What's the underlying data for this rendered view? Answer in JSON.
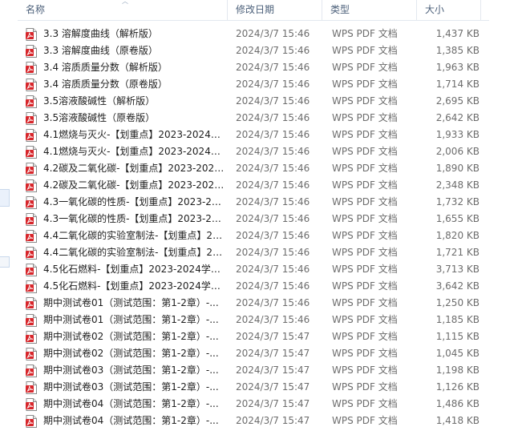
{
  "columns": {
    "name": "名称",
    "date": "修改日期",
    "type": "类型",
    "size": "大小"
  },
  "files": [
    {
      "name": "3.3  溶解度曲线（解析版）",
      "date": "2024/3/7 15:46",
      "type": "WPS PDF 文档",
      "size": "1,437 KB"
    },
    {
      "name": "3.3  溶解度曲线（原卷版）",
      "date": "2024/3/7 15:46",
      "type": "WPS PDF 文档",
      "size": "1,385 KB"
    },
    {
      "name": "3.4 溶质质量分数（解析版）",
      "date": "2024/3/7 15:46",
      "type": "WPS PDF 文档",
      "size": "1,963 KB"
    },
    {
      "name": "3.4 溶质质量分数（原卷版）",
      "date": "2024/3/7 15:46",
      "type": "WPS PDF 文档",
      "size": "1,714 KB"
    },
    {
      "name": "3.5溶液酸碱性（解析版）",
      "date": "2024/3/7 15:46",
      "type": "WPS PDF 文档",
      "size": "2,695 KB"
    },
    {
      "name": "3.5溶液酸碱性（原卷版）",
      "date": "2024/3/7 15:46",
      "type": "WPS PDF 文档",
      "size": "2,642 KB"
    },
    {
      "name": "4.1燃烧与灭火-【划重点】2023-2024学...",
      "date": "2024/3/7 15:46",
      "type": "WPS PDF 文档",
      "size": "1,933 KB"
    },
    {
      "name": "4.1燃烧与灭火-【划重点】2023-2024学...",
      "date": "2024/3/7 15:46",
      "type": "WPS PDF 文档",
      "size": "2,006 KB"
    },
    {
      "name": "4.2碳及二氧化碳-【划重点】2023-2024...",
      "date": "2024/3/7 15:46",
      "type": "WPS PDF 文档",
      "size": "1,890 KB"
    },
    {
      "name": "4.2碳及二氧化碳-【划重点】2023-2024...",
      "date": "2024/3/7 15:46",
      "type": "WPS PDF 文档",
      "size": "2,348 KB"
    },
    {
      "name": "4.3一氧化碳的性质-【划重点】2023-20...",
      "date": "2024/3/7 15:46",
      "type": "WPS PDF 文档",
      "size": "1,732 KB"
    },
    {
      "name": "4.3一氧化碳的性质-【划重点】2023-20...",
      "date": "2024/3/7 15:46",
      "type": "WPS PDF 文档",
      "size": "1,655 KB"
    },
    {
      "name": "4.4二氧化碳的实验室制法-【划重点】20...",
      "date": "2024/3/7 15:46",
      "type": "WPS PDF 文档",
      "size": "1,820 KB"
    },
    {
      "name": "4.4二氧化碳的实验室制法-【划重点】20...",
      "date": "2024/3/7 15:46",
      "type": "WPS PDF 文档",
      "size": "1,721 KB"
    },
    {
      "name": "4.5化石燃料-【划重点】2023-2024学年...",
      "date": "2024/3/7 15:46",
      "type": "WPS PDF 文档",
      "size": "3,713 KB"
    },
    {
      "name": "4.5化石燃料-【划重点】2023-2024学年...",
      "date": "2024/3/7 15:46",
      "type": "WPS PDF 文档",
      "size": "3,642 KB"
    },
    {
      "name": "期中测试卷01（测试范围：第1-2章）-...",
      "date": "2024/3/7 15:46",
      "type": "WPS PDF 文档",
      "size": "1,250 KB"
    },
    {
      "name": "期中测试卷01（测试范围：第1-2章）-...",
      "date": "2024/3/7 15:46",
      "type": "WPS PDF 文档",
      "size": "1,185 KB"
    },
    {
      "name": "期中测试卷02（测试范围：第1-2章）-...",
      "date": "2024/3/7 15:47",
      "type": "WPS PDF 文档",
      "size": "1,115 KB"
    },
    {
      "name": "期中测试卷02（测试范围：第1-2章）-...",
      "date": "2024/3/7 15:47",
      "type": "WPS PDF 文档",
      "size": "1,045 KB"
    },
    {
      "name": "期中测试卷03（测试范围：第1-2章）-...",
      "date": "2024/3/7 15:47",
      "type": "WPS PDF 文档",
      "size": "1,198 KB"
    },
    {
      "name": "期中测试卷03（测试范围：第1-2章）-...",
      "date": "2024/3/7 15:47",
      "type": "WPS PDF 文档",
      "size": "1,126 KB"
    },
    {
      "name": "期中测试卷04（测试范围：第1-2章）-...",
      "date": "2024/3/7 15:47",
      "type": "WPS PDF 文档",
      "size": "1,486 KB"
    },
    {
      "name": "期中测试卷04（测试范围：第1-2章）-...",
      "date": "2024/3/7 15:47",
      "type": "WPS PDF 文档",
      "size": "1,418 KB"
    }
  ],
  "icons": {
    "file_icon": "pdf-file-icon",
    "sort_icon": "sort-up-arrow-icon"
  },
  "colors": {
    "pdf_icon_red": "#d7262b",
    "header_text": "#4c607a",
    "meta_text": "#6d6d6d"
  }
}
